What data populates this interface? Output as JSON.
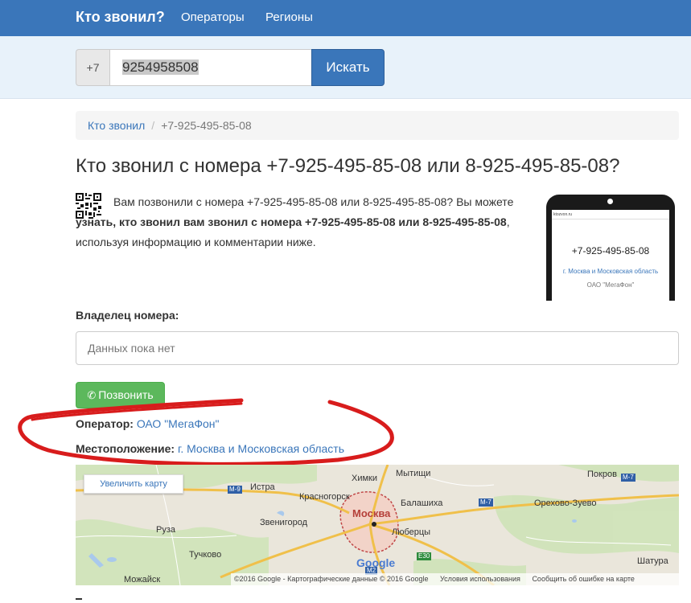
{
  "nav": {
    "brand": "Кто звонил?",
    "links": [
      "Операторы",
      "Регионы"
    ]
  },
  "search": {
    "prefix": "+7",
    "value": "9254958508",
    "button": "Искать"
  },
  "breadcrumb": {
    "home": "Кто звонил",
    "separator": "/",
    "current": "+7-925-495-85-08"
  },
  "page": {
    "title": "Кто звонил с номера +7-925-495-85-08 или 8-925-495-85-08?",
    "intro_1": "Вам позвонили с номера +7-925-495-85-08 или 8-925-495-85-08? Вы можете ",
    "intro_bold": "узнать, кто звонил вам звонил с номера +7-925-495-85-08 или 8-925-495-85-08",
    "intro_2": ", используя информацию и комментарии ниже."
  },
  "phone_card": {
    "site": "ktozvon.ru",
    "number": "+7-925-495-85-08",
    "region": "г. Москва и Московская область",
    "operator": "ОАО \"МегаФон\""
  },
  "owner": {
    "label": "Владелец номера:",
    "placeholder": "Данных пока нет"
  },
  "call_button": "Позвонить",
  "operator": {
    "label": "Оператор:",
    "value": "ОАО \"МегаФон\""
  },
  "location": {
    "label": "Местоположение:",
    "value": "г. Москва и Московская область"
  },
  "map": {
    "zoom_button": "Увеличить карту",
    "labels": {
      "himki": "Химки",
      "mytishchi": "Мытищи",
      "istra": "Истра",
      "krasnogorsk": "Красногорск",
      "balashikha": "Балашиха",
      "moskva": "Москва",
      "pokrov": "Покров",
      "orekhovo": "Орехово-Зуево",
      "zvenigorod": "Звенигород",
      "ruza": "Руза",
      "lyubertsy": "Люберцы",
      "tuchkovo": "Тучково",
      "shatura": "Шатура",
      "mozhaysk": "Можайск"
    },
    "roads": {
      "m9": "М-9",
      "m7a": "М-7",
      "m7b": "М-7",
      "e30": "E30",
      "m2": "М2"
    },
    "google": "Google",
    "copyright": "©2016 Google - Картографические данные © 2016 Google",
    "terms": "Условия использования",
    "report": "Сообщить об ошибке на карте"
  }
}
